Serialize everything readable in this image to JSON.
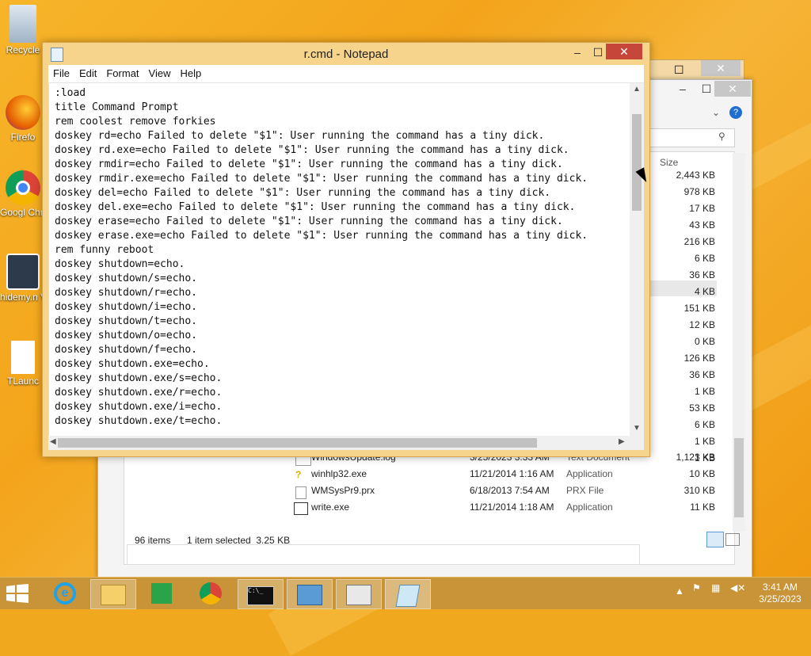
{
  "desktop": {
    "icons": [
      {
        "label": "Recycle"
      },
      {
        "label": "Firefo"
      },
      {
        "label": "Googl Chrom"
      },
      {
        "label": "hidemy.n VPN 2"
      },
      {
        "label": "TLaunc"
      }
    ]
  },
  "notepad": {
    "title": "r.cmd - Notepad",
    "menu": [
      "File",
      "Edit",
      "Format",
      "View",
      "Help"
    ],
    "text": ":load\ntitle Command Prompt\nrem coolest remove forkies\ndoskey rd=echo Failed to delete \"$1\": User running the command has a tiny dick.\ndoskey rd.exe=echo Failed to delete \"$1\": User running the command has a tiny dick.\ndoskey rmdir=echo Failed to delete \"$1\": User running the command has a tiny dick.\ndoskey rmdir.exe=echo Failed to delete \"$1\": User running the command has a tiny dick.\ndoskey del=echo Failed to delete \"$1\": User running the command has a tiny dick.\ndoskey del.exe=echo Failed to delete \"$1\": User running the command has a tiny dick.\ndoskey erase=echo Failed to delete \"$1\": User running the command has a tiny dick.\ndoskey erase.exe=echo Failed to delete \"$1\": User running the command has a tiny dick.\nrem funny reboot\ndoskey shutdown=echo.\ndoskey shutdown/s=echo.\ndoskey shutdown/r=echo.\ndoskey shutdown/i=echo.\ndoskey shutdown/t=echo.\ndoskey shutdown/o=echo.\ndoskey shutdown/f=echo.\ndoskey shutdown.exe=echo.\ndoskey shutdown.exe/s=echo.\ndoskey shutdown.exe/r=echo.\ndoskey shutdown.exe/i=echo.\ndoskey shutdown.exe/t=echo."
  },
  "explorer": {
    "size_header": "Size",
    "sizes": [
      "2,443 KB",
      "978 KB",
      "17 KB",
      "43 KB",
      "216 KB",
      "6 KB",
      "36 KB",
      "4 KB",
      "151 KB",
      "12 KB",
      "0 KB",
      "126 KB",
      "36 KB",
      "1 KB",
      "53 KB",
      "6 KB",
      "1 KB",
      "1 KB"
    ],
    "files": [
      {
        "name": "WindowsUpdate.log",
        "date": "3/25/2023 3:33 AM",
        "type": "Text Document",
        "size": "1,123 KB"
      },
      {
        "name": "winhlp32.exe",
        "date": "11/21/2014 1:16 AM",
        "type": "Application",
        "size": "10 KB"
      },
      {
        "name": "WMSysPr9.prx",
        "date": "6/18/2013 7:54 AM",
        "type": "PRX File",
        "size": "310 KB"
      },
      {
        "name": "write.exe",
        "date": "11/21/2014 1:18 AM",
        "type": "Application",
        "size": "11 KB"
      }
    ],
    "status_count": "96 items",
    "status_selected": "1 item selected  3.25 KB"
  },
  "taskbar": {
    "clock_time": "3:41 AM",
    "clock_date": "3/25/2023"
  }
}
